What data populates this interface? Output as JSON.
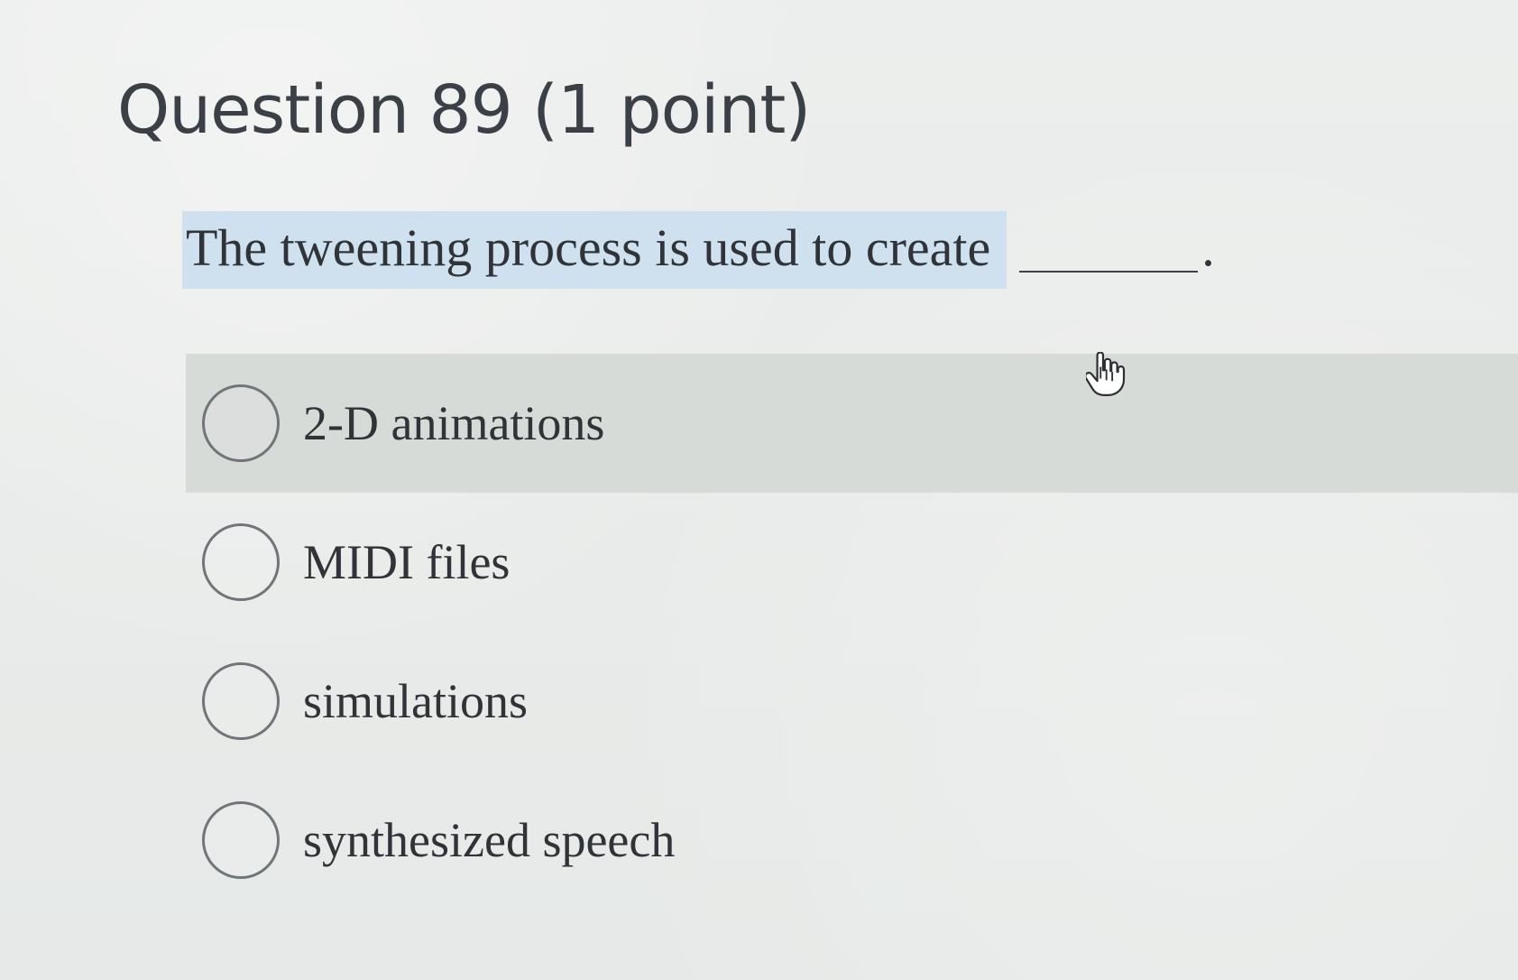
{
  "question": {
    "title": "Question 89 (1 point)",
    "prompt": "The tweening process is used to create",
    "terminal_punctuation": "."
  },
  "choices": [
    {
      "label": "2-D animations",
      "hovered": true
    },
    {
      "label": "MIDI files",
      "hovered": false
    },
    {
      "label": "simulations",
      "hovered": false
    },
    {
      "label": "synthesized speech",
      "hovered": false
    }
  ],
  "cursor": {
    "icon": "hand-pointer-icon"
  },
  "colors": {
    "background": "#e9ecea",
    "prompt_highlight": "#cfe0ef",
    "hover_row": "#d7dbd8",
    "text": "#303338",
    "radio_border": "#70757a"
  }
}
